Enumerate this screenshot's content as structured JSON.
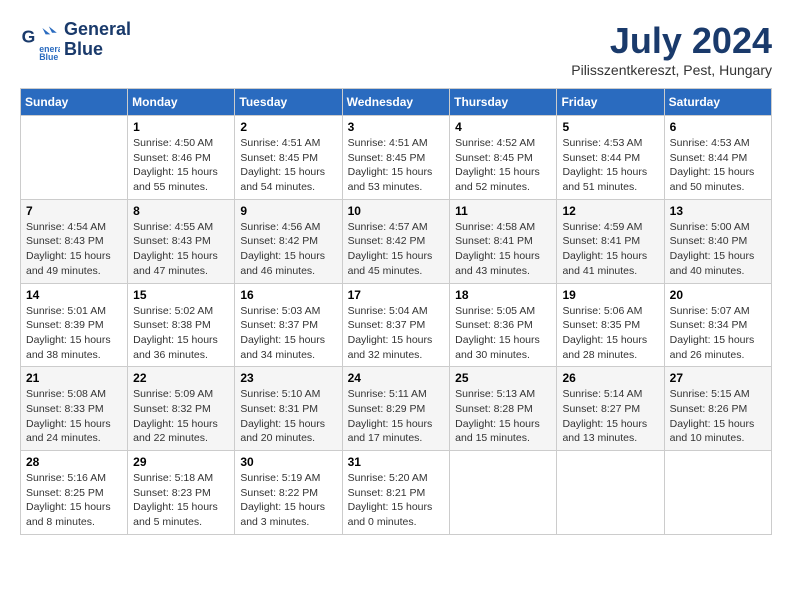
{
  "logo": {
    "line1": "General",
    "line2": "Blue"
  },
  "title": "July 2024",
  "location": "Pilisszentkereszt, Pest, Hungary",
  "weekdays": [
    "Sunday",
    "Monday",
    "Tuesday",
    "Wednesday",
    "Thursday",
    "Friday",
    "Saturday"
  ],
  "weeks": [
    [
      {
        "day": "",
        "info": ""
      },
      {
        "day": "1",
        "info": "Sunrise: 4:50 AM\nSunset: 8:46 PM\nDaylight: 15 hours\nand 55 minutes."
      },
      {
        "day": "2",
        "info": "Sunrise: 4:51 AM\nSunset: 8:45 PM\nDaylight: 15 hours\nand 54 minutes."
      },
      {
        "day": "3",
        "info": "Sunrise: 4:51 AM\nSunset: 8:45 PM\nDaylight: 15 hours\nand 53 minutes."
      },
      {
        "day": "4",
        "info": "Sunrise: 4:52 AM\nSunset: 8:45 PM\nDaylight: 15 hours\nand 52 minutes."
      },
      {
        "day": "5",
        "info": "Sunrise: 4:53 AM\nSunset: 8:44 PM\nDaylight: 15 hours\nand 51 minutes."
      },
      {
        "day": "6",
        "info": "Sunrise: 4:53 AM\nSunset: 8:44 PM\nDaylight: 15 hours\nand 50 minutes."
      }
    ],
    [
      {
        "day": "7",
        "info": "Sunrise: 4:54 AM\nSunset: 8:43 PM\nDaylight: 15 hours\nand 49 minutes."
      },
      {
        "day": "8",
        "info": "Sunrise: 4:55 AM\nSunset: 8:43 PM\nDaylight: 15 hours\nand 47 minutes."
      },
      {
        "day": "9",
        "info": "Sunrise: 4:56 AM\nSunset: 8:42 PM\nDaylight: 15 hours\nand 46 minutes."
      },
      {
        "day": "10",
        "info": "Sunrise: 4:57 AM\nSunset: 8:42 PM\nDaylight: 15 hours\nand 45 minutes."
      },
      {
        "day": "11",
        "info": "Sunrise: 4:58 AM\nSunset: 8:41 PM\nDaylight: 15 hours\nand 43 minutes."
      },
      {
        "day": "12",
        "info": "Sunrise: 4:59 AM\nSunset: 8:41 PM\nDaylight: 15 hours\nand 41 minutes."
      },
      {
        "day": "13",
        "info": "Sunrise: 5:00 AM\nSunset: 8:40 PM\nDaylight: 15 hours\nand 40 minutes."
      }
    ],
    [
      {
        "day": "14",
        "info": "Sunrise: 5:01 AM\nSunset: 8:39 PM\nDaylight: 15 hours\nand 38 minutes."
      },
      {
        "day": "15",
        "info": "Sunrise: 5:02 AM\nSunset: 8:38 PM\nDaylight: 15 hours\nand 36 minutes."
      },
      {
        "day": "16",
        "info": "Sunrise: 5:03 AM\nSunset: 8:37 PM\nDaylight: 15 hours\nand 34 minutes."
      },
      {
        "day": "17",
        "info": "Sunrise: 5:04 AM\nSunset: 8:37 PM\nDaylight: 15 hours\nand 32 minutes."
      },
      {
        "day": "18",
        "info": "Sunrise: 5:05 AM\nSunset: 8:36 PM\nDaylight: 15 hours\nand 30 minutes."
      },
      {
        "day": "19",
        "info": "Sunrise: 5:06 AM\nSunset: 8:35 PM\nDaylight: 15 hours\nand 28 minutes."
      },
      {
        "day": "20",
        "info": "Sunrise: 5:07 AM\nSunset: 8:34 PM\nDaylight: 15 hours\nand 26 minutes."
      }
    ],
    [
      {
        "day": "21",
        "info": "Sunrise: 5:08 AM\nSunset: 8:33 PM\nDaylight: 15 hours\nand 24 minutes."
      },
      {
        "day": "22",
        "info": "Sunrise: 5:09 AM\nSunset: 8:32 PM\nDaylight: 15 hours\nand 22 minutes."
      },
      {
        "day": "23",
        "info": "Sunrise: 5:10 AM\nSunset: 8:31 PM\nDaylight: 15 hours\nand 20 minutes."
      },
      {
        "day": "24",
        "info": "Sunrise: 5:11 AM\nSunset: 8:29 PM\nDaylight: 15 hours\nand 17 minutes."
      },
      {
        "day": "25",
        "info": "Sunrise: 5:13 AM\nSunset: 8:28 PM\nDaylight: 15 hours\nand 15 minutes."
      },
      {
        "day": "26",
        "info": "Sunrise: 5:14 AM\nSunset: 8:27 PM\nDaylight: 15 hours\nand 13 minutes."
      },
      {
        "day": "27",
        "info": "Sunrise: 5:15 AM\nSunset: 8:26 PM\nDaylight: 15 hours\nand 10 minutes."
      }
    ],
    [
      {
        "day": "28",
        "info": "Sunrise: 5:16 AM\nSunset: 8:25 PM\nDaylight: 15 hours\nand 8 minutes."
      },
      {
        "day": "29",
        "info": "Sunrise: 5:18 AM\nSunset: 8:23 PM\nDaylight: 15 hours\nand 5 minutes."
      },
      {
        "day": "30",
        "info": "Sunrise: 5:19 AM\nSunset: 8:22 PM\nDaylight: 15 hours\nand 3 minutes."
      },
      {
        "day": "31",
        "info": "Sunrise: 5:20 AM\nSunset: 8:21 PM\nDaylight: 15 hours\nand 0 minutes."
      },
      {
        "day": "",
        "info": ""
      },
      {
        "day": "",
        "info": ""
      },
      {
        "day": "",
        "info": ""
      }
    ]
  ]
}
